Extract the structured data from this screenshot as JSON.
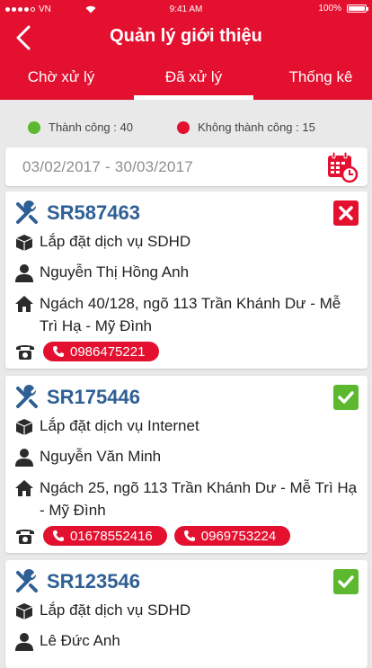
{
  "status_bar": {
    "carrier": "VN",
    "time": "9:41 AM",
    "battery": "100%"
  },
  "header": {
    "title": "Quản lý giới thiệu"
  },
  "tabs": [
    {
      "label": "Chờ xử lý",
      "active": false
    },
    {
      "label": "Đã xử lý",
      "active": true
    },
    {
      "label": "Thống kê",
      "active": false
    }
  ],
  "summary": {
    "success": {
      "label": "Thành công : 40",
      "color": "#5cb82e"
    },
    "fail": {
      "label": "Không thành công : 15",
      "color": "#e3102f"
    }
  },
  "date_range": {
    "value": "03/02/2017 - 30/03/2017"
  },
  "records": [
    {
      "code": "SR587463",
      "status": "failed",
      "service": "Lắp đặt dịch vụ SDHD",
      "customer": "Nguyễn Thị Hồng Anh",
      "address": "Ngách 40/128, ngõ 113 Trần Khánh Dư - Mễ Trì Hạ - Mỹ Đình",
      "phones": [
        "0986475221"
      ]
    },
    {
      "code": "SR175446",
      "status": "success",
      "service": "Lắp đặt dịch vụ Internet",
      "customer": "Nguyễn Văn Minh",
      "address": "Ngách 25, ngõ 113 Trần Khánh Dư - Mễ Trì Hạ - Mỹ Đình",
      "phones": [
        "01678552416",
        "0969753224"
      ]
    },
    {
      "code": "SR123546",
      "status": "success",
      "service": "Lắp đặt dịch vụ SDHD",
      "customer": "Lê Đức Anh"
    }
  ]
}
